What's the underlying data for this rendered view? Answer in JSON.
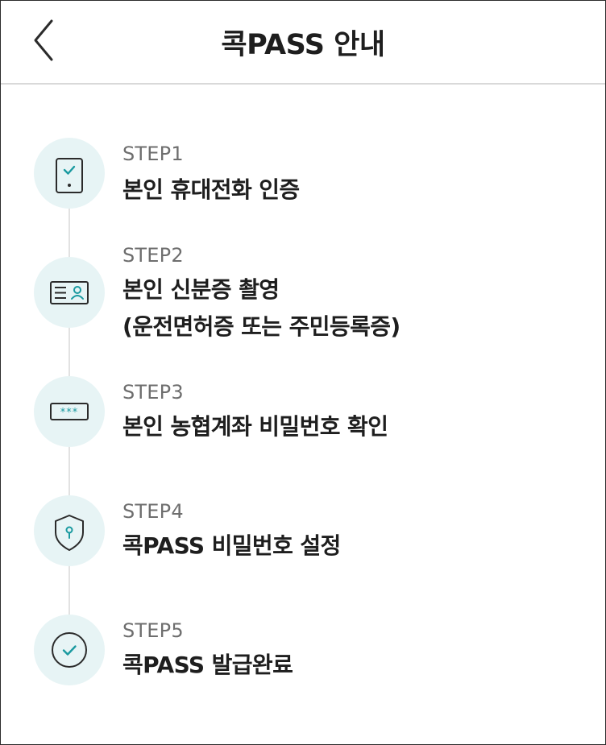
{
  "header": {
    "title": "콕PASS 안내",
    "back_icon": "chevron-left-icon"
  },
  "colors": {
    "accent": "#1a9aa0",
    "circle_bg": "#e7f4f5",
    "icon_stroke": "#2b2b2b"
  },
  "steps": [
    {
      "label": "STEP1",
      "lines": [
        "본인 휴대전화 인증"
      ],
      "icon": "mobile-check-icon"
    },
    {
      "label": "STEP2",
      "lines": [
        "본인 신분증 촬영",
        "(운전면허증 또는 주민등록증)"
      ],
      "icon": "id-card-icon"
    },
    {
      "label": "STEP3",
      "lines": [
        "본인 농협계좌 비밀번호 확인"
      ],
      "icon": "password-field-icon"
    },
    {
      "label": "STEP4",
      "lines": [
        "콕PASS 비밀번호 설정"
      ],
      "icon": "shield-key-icon"
    },
    {
      "label": "STEP5",
      "lines": [
        "콕PASS 발급완료"
      ],
      "icon": "check-circle-icon"
    }
  ]
}
